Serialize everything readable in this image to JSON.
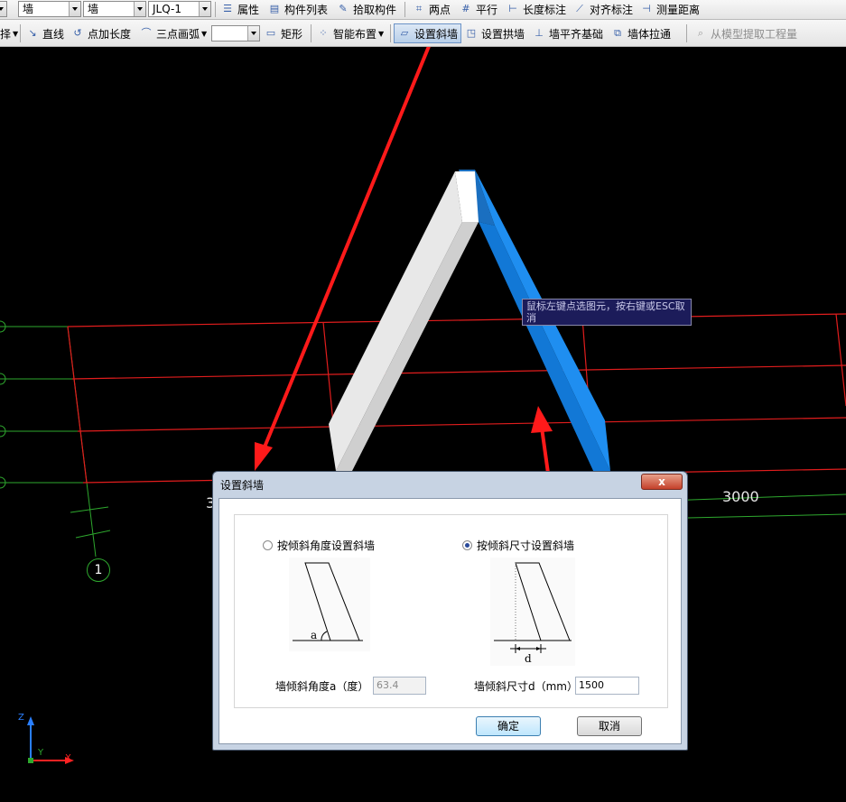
{
  "toolbar1": {
    "combo1": "墙",
    "combo2": "墙",
    "combo3": "JLQ-1",
    "properties": "属性",
    "component_list": "构件列表",
    "pick_component": "拾取构件",
    "two_points": "两点",
    "parallel": "平行",
    "length_dim": "长度标注",
    "aligned_dim": "对齐标注",
    "measure_distance": "测量距离"
  },
  "toolbar2": {
    "select_partial": "择",
    "line": "直线",
    "point_length": "点加长度",
    "three_point_arc": "三点画弧",
    "rectangle": "矩形",
    "smart_layout": "智能布置",
    "set_slant_wall": "设置斜墙",
    "set_arch_wall": "设置拱墙",
    "wall_align_base": "墙平齐基础",
    "wall_stretch": "墙体拉通",
    "extract_quantity": "从模型提取工程量"
  },
  "canvas": {
    "tooltip": "鼠标左键点选图元，按右键或ESC取消",
    "dim_right": "3000",
    "dim_left": "3",
    "axis_label": "1",
    "ucs_z": "Z",
    "ucs_y": "Y",
    "ucs_x": "X",
    "colors": {
      "background": "#000000",
      "grid_red": "#e11d1d",
      "grid_green": "#2ea82e",
      "wall_blue": "#1f8ef0",
      "wall_white": "#e8e8e8",
      "arrow": "#ff1a1a"
    }
  },
  "dialog": {
    "title": "设置斜墙",
    "close_label": "x",
    "option_angle": "按倾斜角度设置斜墙",
    "option_size": "按倾斜尺寸设置斜墙",
    "selected_option": "size",
    "pic_angle_label": "a",
    "pic_size_label": "d",
    "angle_field_label": "墙倾斜角度a（度）",
    "angle_value": "63.4",
    "size_field_label": "墙倾斜尺寸d（mm）",
    "size_value": "1500",
    "ok": "确定",
    "cancel": "取消"
  }
}
